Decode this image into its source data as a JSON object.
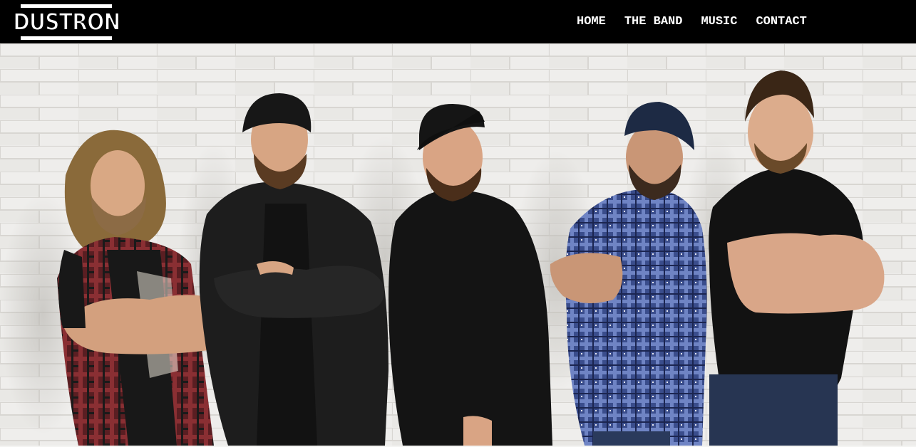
{
  "logo": {
    "text": "DUSTRON"
  },
  "nav": {
    "items": [
      {
        "label": "HOME"
      },
      {
        "label": "THE BAND"
      },
      {
        "label": "MUSIC"
      },
      {
        "label": "CONTACT"
      }
    ]
  },
  "hero": {
    "members": [
      {
        "shirt": "#7a2a2e",
        "pattern": "plaid-red",
        "hair": "#8a6a3a",
        "hat": "none"
      },
      {
        "shirt": "#1c1c1c",
        "pattern": "leather",
        "hair": "#3a2a1a",
        "hat": "beanie"
      },
      {
        "shirt": "#141414",
        "pattern": "sweater",
        "hair": "#2a1e14",
        "hat": "cap"
      },
      {
        "shirt": "#3b4f8f",
        "pattern": "plaid-blue",
        "hair": "#3a2a1a",
        "hat": "beanie-navy"
      },
      {
        "shirt": "#111111",
        "pattern": "tshirt",
        "hair": "#3a2616",
        "hat": "none"
      }
    ]
  },
  "colors": {
    "header_bg": "#000000",
    "nav_text": "#ffffff",
    "wall": "#ecebe9",
    "mortar": "#d6d4d0"
  }
}
